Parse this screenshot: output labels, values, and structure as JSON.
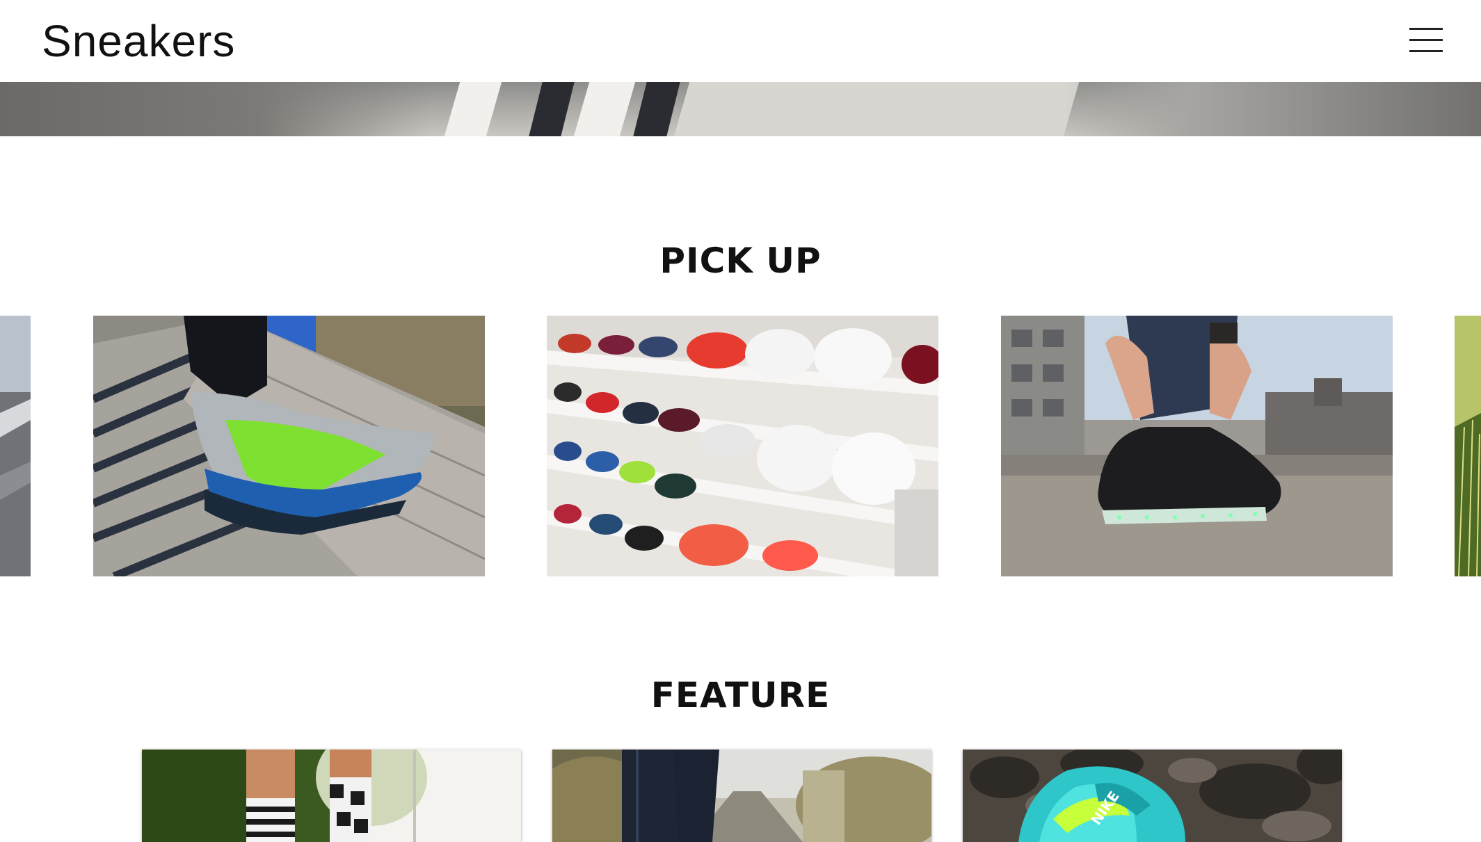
{
  "header": {
    "logo": "Sneakers",
    "menu_icon": "hamburger-menu-icon"
  },
  "hero": {
    "image": "street-crosswalk-banner"
  },
  "pickup": {
    "title": "PICK UP",
    "cards": [
      {
        "image": "street-asphalt-edge"
      },
      {
        "image": "green-sneaker-on-bench"
      },
      {
        "image": "sneaker-wall-shelf"
      },
      {
        "image": "light-up-sneaker-tying"
      },
      {
        "image": "sneaker-in-grass-edge"
      }
    ]
  },
  "feature": {
    "title": "FEATURE",
    "cards": [
      {
        "image": "striped-socks-legs"
      },
      {
        "image": "jeans-on-road"
      },
      {
        "image": "teal-nike-sneaker-on-rocks"
      }
    ]
  },
  "colors": {
    "text": "#111111",
    "background": "#ffffff"
  }
}
